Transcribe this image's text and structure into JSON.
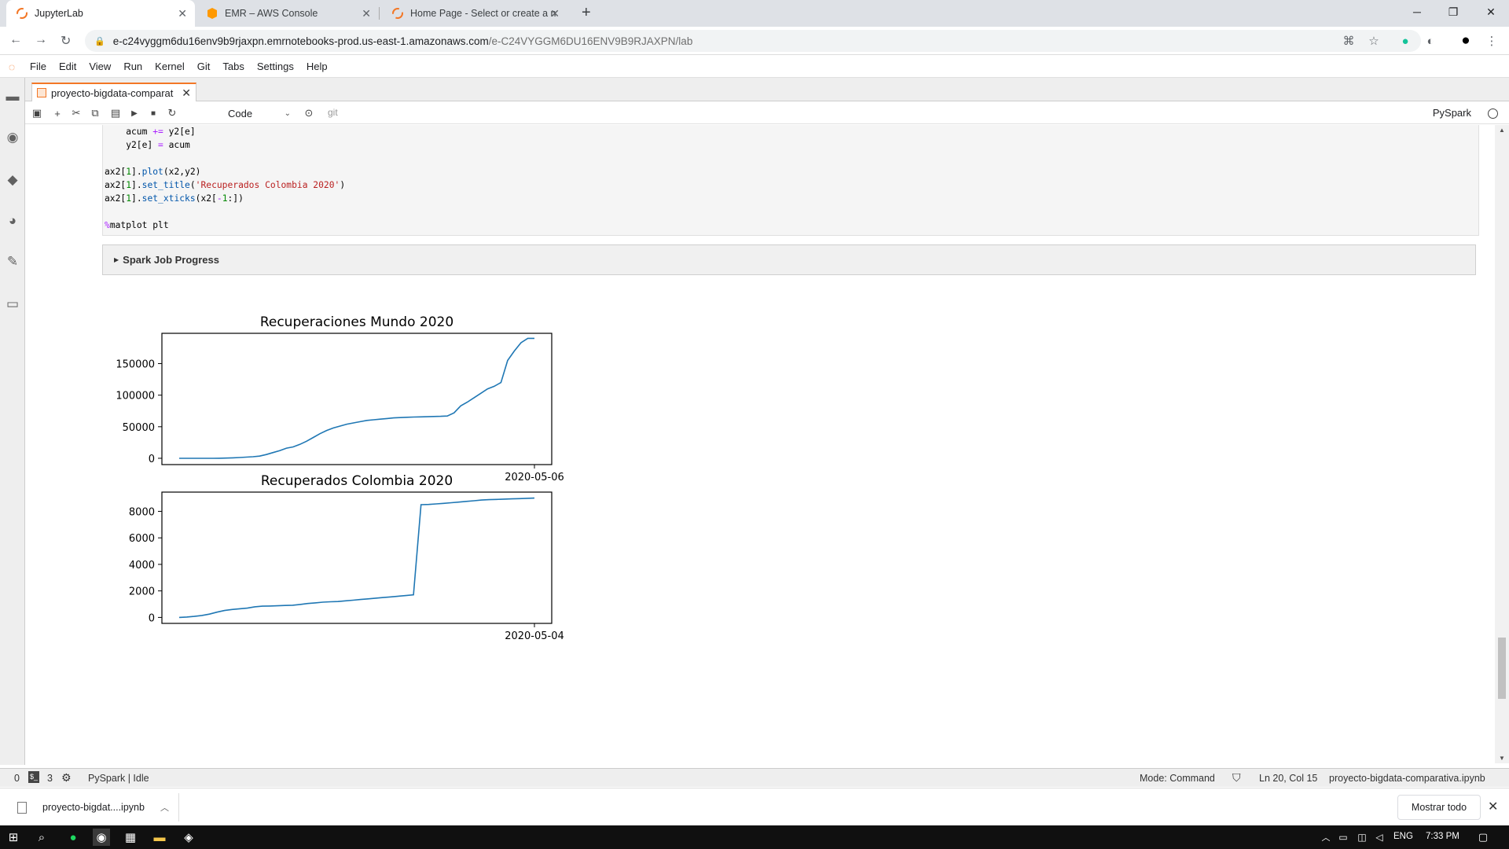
{
  "browser": {
    "tabs": [
      {
        "title": "JupyterLab",
        "active": true
      },
      {
        "title": "EMR – AWS Console",
        "active": false
      },
      {
        "title": "Home Page - Select or create a n",
        "active": false
      }
    ],
    "url_host": "e-c24vyggm6du16env9b9rjaxpn.emrnotebooks-prod.us-east-1.amazonaws.com",
    "url_path": "/e-C24VYGGM6DU16ENV9B9RJAXPN/lab"
  },
  "menubar": {
    "items": [
      "File",
      "Edit",
      "View",
      "Run",
      "Kernel",
      "Git",
      "Tabs",
      "Settings",
      "Help"
    ]
  },
  "doc_tab": {
    "title": "proyecto-bigdata-comparat"
  },
  "toolbar": {
    "cell_type": "Code",
    "git_label": "git",
    "kernel_name": "PySpark"
  },
  "code_lines": [
    "    acum += y2[e]",
    "    y2[e] = acum",
    "",
    "ax2[1].plot(x2,y2)",
    "ax2[1].set_title('Recuperados Colombia 2020')",
    "ax2[1].set_xticks(x2[-1:])",
    "",
    "%matplot plt"
  ],
  "spark_progress": {
    "label": "Spark Job Progress"
  },
  "charts": {
    "world": {
      "title": "Recuperaciones Mundo 2020",
      "yticks": [
        "0",
        "50000",
        "100000",
        "150000"
      ],
      "xtick": "2020-05-06"
    },
    "colombia": {
      "title": "Recuperados Colombia 2020",
      "yticks": [
        "0",
        "2000",
        "4000",
        "6000",
        "8000"
      ],
      "xtick": "2020-05-04"
    }
  },
  "chart_data": [
    {
      "type": "line",
      "title": "Recuperaciones Mundo 2020",
      "xticks": [
        "2020-05-06"
      ],
      "ylim": [
        -10000,
        198000
      ],
      "color": "#1f77b4",
      "values": [
        0,
        0,
        0,
        0,
        0,
        0,
        100,
        300,
        700,
        1200,
        1800,
        2500,
        3500,
        6000,
        9000,
        12000,
        16000,
        18000,
        22000,
        27000,
        33000,
        39000,
        44000,
        48000,
        51000,
        54000,
        56000,
        58000,
        60000,
        61000,
        62000,
        63000,
        64000,
        64500,
        65000,
        65300,
        65600,
        65900,
        66200,
        66500,
        67000,
        72000,
        83000,
        89000,
        96000,
        103000,
        110000,
        114000,
        120000,
        155000,
        170000,
        183000,
        190000,
        190000
      ]
    },
    {
      "type": "line",
      "title": "Recuperados Colombia 2020",
      "xticks": [
        "2020-05-04"
      ],
      "ylim": [
        -450,
        9450
      ],
      "color": "#1f77b4",
      "values": [
        0,
        30,
        80,
        150,
        250,
        400,
        520,
        600,
        650,
        700,
        800,
        850,
        860,
        880,
        900,
        920,
        980,
        1050,
        1100,
        1150,
        1180,
        1200,
        1250,
        1300,
        1350,
        1400,
        1450,
        1500,
        1550,
        1600,
        1650,
        1700,
        8500,
        8520,
        8560,
        8600,
        8650,
        8700,
        8750,
        8800,
        8850,
        8880,
        8900,
        8920,
        8940,
        8960,
        8980,
        9000
      ]
    }
  ],
  "statusbar": {
    "terminals": "0",
    "kernels": "3",
    "kernel_status": "PySpark | Idle",
    "mode": "Mode: Command",
    "position": "Ln 20, Col 15",
    "filename": "proyecto-bigdata-comparativa.ipynb"
  },
  "downloads": {
    "file": "proyecto-bigdat....ipynb",
    "show_all": "Mostrar todo"
  },
  "taskbar": {
    "lang": "ENG",
    "time": "7:33 PM"
  }
}
